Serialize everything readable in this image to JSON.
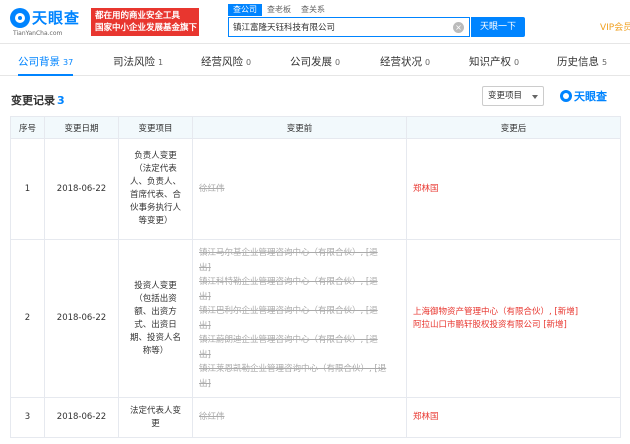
{
  "brand": {
    "name": "天眼查",
    "url": "TianYanCha.com",
    "promo_line1": "都在用的商业安全工具",
    "promo_line2": "国家中小企业发展基金旗下"
  },
  "search": {
    "tabs": [
      "查公司",
      "查老板",
      "查关系"
    ],
    "value": "镇江富隆天钰科技有限公司",
    "button": "天眼一下"
  },
  "vip": "VIP会员",
  "nav": [
    {
      "label": "公司背景",
      "count": "37"
    },
    {
      "label": "司法风险",
      "count": "1"
    },
    {
      "label": "经营风险",
      "count": "0"
    },
    {
      "label": "公司发展",
      "count": "0"
    },
    {
      "label": "经营状况",
      "count": "0"
    },
    {
      "label": "知识产权",
      "count": "0"
    },
    {
      "label": "历史信息",
      "count": "5"
    }
  ],
  "section": {
    "title": "变更记录",
    "count": "3",
    "filter_label": "变更项目",
    "watermark": "天眼查"
  },
  "table": {
    "headers": [
      "序号",
      "变更日期",
      "变更项目",
      "变更前",
      "变更后"
    ],
    "rows": [
      {
        "index": "1",
        "date": "2018-06-22",
        "item": [
          "负责人变更",
          "（法定代表",
          "人、负责人、",
          "首席代表、合",
          "伙事务执行人",
          "等变更）"
        ],
        "before": [
          "徐红伟"
        ],
        "after": [
          "郑林国"
        ]
      },
      {
        "index": "2",
        "date": "2018-06-22",
        "item": [
          "投资人变更",
          "（包括出资",
          "额、出资方",
          "式、出资日",
          "期、投资人名",
          "称等）"
        ],
        "before": [
          "镇江马尔基企业管理咨询中心（有限合伙）, [退",
          "出]",
          "镇江科特勒企业管理咨询中心（有限合伙）, [退",
          "出]",
          "镇江巴利尔企业管理咨询中心（有限合伙）, [退",
          "出]",
          "镇江蔚朗迪企业管理咨询中心（有限合伙）, [退",
          "出]",
          "镇江莱恩凯勒企业管理咨询中心（有限合伙）, [退",
          "出]"
        ],
        "after": [
          "上海御物资产管理中心（有限合伙）, [新增]",
          "阿拉山口市鹏轩股权投资有限公司 [新增]"
        ]
      },
      {
        "index": "3",
        "date": "2018-06-22",
        "item": [
          "法定代表人变",
          "更"
        ],
        "before": [
          "徐红伟"
        ],
        "after": [
          "郑林国"
        ]
      }
    ]
  }
}
